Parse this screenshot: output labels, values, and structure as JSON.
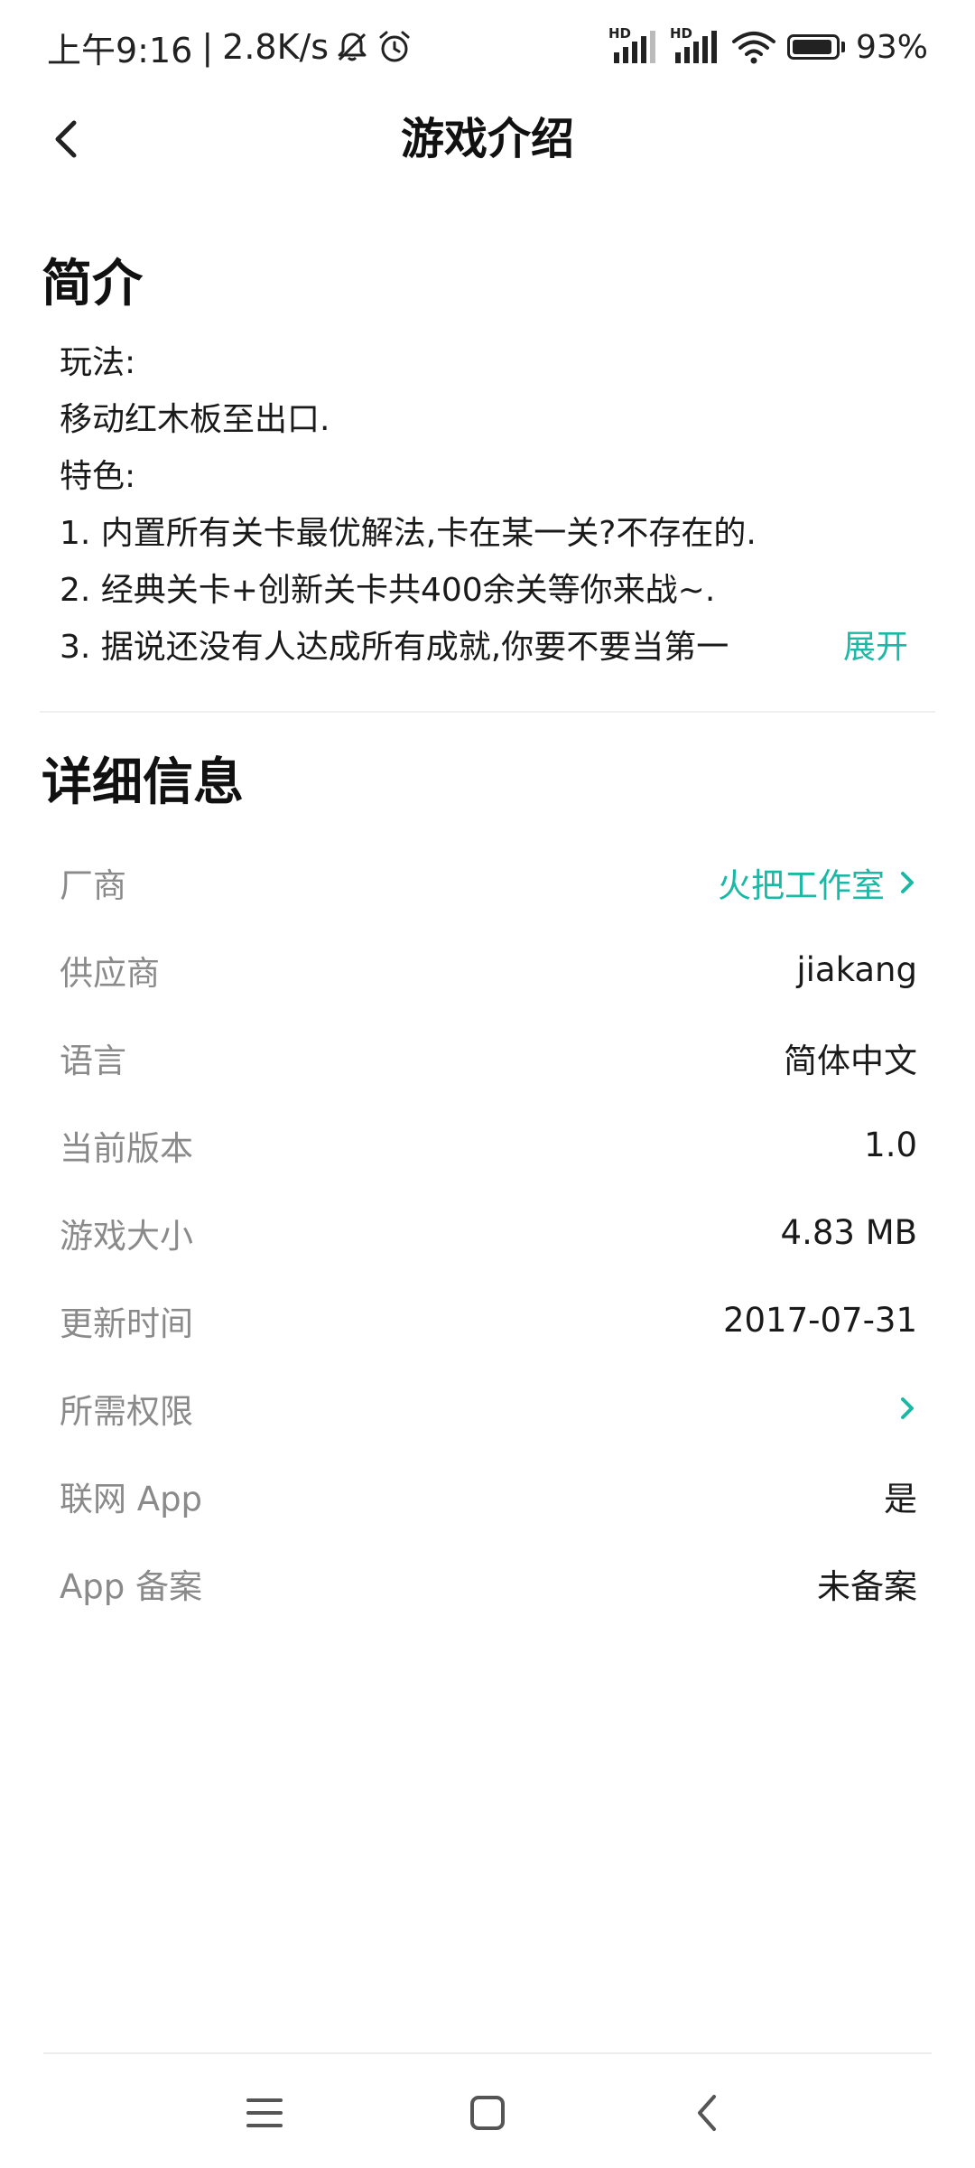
{
  "status_bar": {
    "time": "上午9:16",
    "separator": "|",
    "speed": "2.8K/s",
    "battery_percent": 93,
    "battery_label": "93%",
    "signal_badge": "HD",
    "icons": [
      "bell-off-icon",
      "alarm-icon",
      "hd-signal-icon",
      "hd-signal-icon",
      "wifi-icon",
      "battery-icon"
    ]
  },
  "header": {
    "title": "游戏介绍",
    "back_icon": "chevron-left-icon"
  },
  "intro": {
    "heading": "简介",
    "lines": [
      "玩法:",
      "移动红木板至出口.",
      "特色:",
      "1. 内置所有关卡最优解法,卡在某一关?不存在的.",
      "2. 经典关卡+创新关卡共400余关等你来战~."
    ],
    "truncated_line": "3. 据说还没有人达成所有成就,你要不要当第一",
    "expand_label": "展开"
  },
  "details": {
    "heading": "详细信息",
    "rows": [
      {
        "label": "厂商",
        "value": "火把工作室",
        "link": true
      },
      {
        "label": "供应商",
        "value": "jiakang"
      },
      {
        "label": "语言",
        "value": "简体中文"
      },
      {
        "label": "当前版本",
        "value": "1.0"
      },
      {
        "label": "游戏大小",
        "value": "4.83 MB"
      },
      {
        "label": "更新时间",
        "value": "2017-07-31"
      },
      {
        "label": "所需权限",
        "value": ""
      },
      {
        "label": "联网 App",
        "value": "是"
      },
      {
        "label": "App 备案",
        "value": "未备案"
      }
    ]
  },
  "nav_bar": {
    "icons": [
      "menu-icon",
      "home-icon",
      "back-icon"
    ]
  },
  "colors": {
    "accent": "#1bb8a5",
    "label_gray": "#8a8a8a",
    "text": "#1a1a1a"
  }
}
